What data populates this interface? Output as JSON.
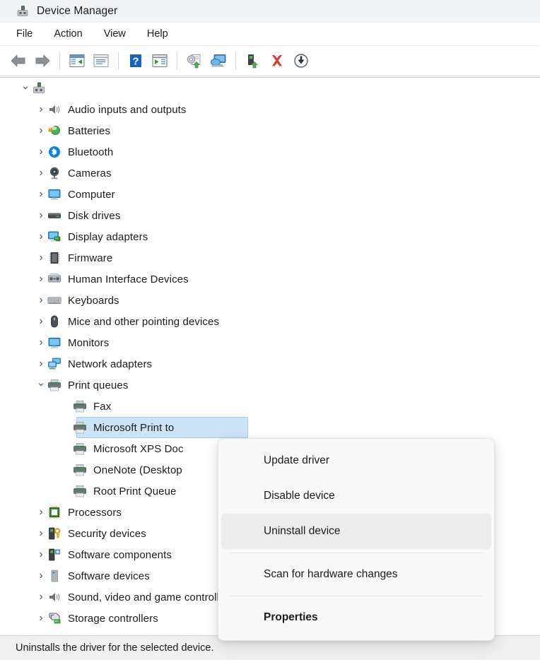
{
  "window": {
    "title": "Device Manager",
    "title_icon": "device-manager-icon"
  },
  "menubar": {
    "items": [
      {
        "label": "File",
        "name": "menu-file"
      },
      {
        "label": "Action",
        "name": "menu-action"
      },
      {
        "label": "View",
        "name": "menu-view"
      },
      {
        "label": "Help",
        "name": "menu-help"
      }
    ]
  },
  "toolbar": {
    "buttons": [
      {
        "icon": "back-arrow-icon",
        "title": "Back"
      },
      {
        "icon": "forward-arrow-icon",
        "title": "Forward"
      },
      {
        "icon": "show-hide-console-tree-icon",
        "title": "Show/Hide Console Tree"
      },
      {
        "icon": "properties-window-icon",
        "title": "Properties"
      },
      {
        "icon": "help-question-icon",
        "title": "Help"
      },
      {
        "icon": "show-hide-action-pane-icon",
        "title": "Show/Hide Action Pane"
      },
      {
        "icon": "update-driver-icon",
        "title": "Update driver"
      },
      {
        "icon": "scan-hardware-changes-icon",
        "title": "Scan for hardware changes"
      },
      {
        "icon": "disable-device-icon",
        "title": "Disable device"
      },
      {
        "icon": "uninstall-device-red-x-icon",
        "title": "Uninstall device"
      },
      {
        "icon": "download-circle-icon",
        "title": "Install legacy hardware"
      }
    ]
  },
  "tree": {
    "root": {
      "label": "",
      "icon": "computer-root-icon",
      "expanded": true
    },
    "items": [
      {
        "label": "Audio inputs and outputs",
        "icon": "speaker-icon",
        "level": 1,
        "expanded": false,
        "selected": false
      },
      {
        "label": "Batteries",
        "icon": "battery-icon",
        "level": 1,
        "expanded": false,
        "selected": false
      },
      {
        "label": "Bluetooth",
        "icon": "bluetooth-icon",
        "level": 1,
        "expanded": false,
        "selected": false
      },
      {
        "label": "Cameras",
        "icon": "camera-icon",
        "level": 1,
        "expanded": false,
        "selected": false
      },
      {
        "label": "Computer",
        "icon": "monitor-icon",
        "level": 1,
        "expanded": false,
        "selected": false
      },
      {
        "label": "Disk drives",
        "icon": "disk-drive-icon",
        "level": 1,
        "expanded": false,
        "selected": false
      },
      {
        "label": "Display adapters",
        "icon": "display-adapter-icon",
        "level": 1,
        "expanded": false,
        "selected": false
      },
      {
        "label": "Firmware",
        "icon": "firmware-chip-icon",
        "level": 1,
        "expanded": false,
        "selected": false
      },
      {
        "label": "Human Interface Devices",
        "icon": "hid-icon",
        "level": 1,
        "expanded": false,
        "selected": false
      },
      {
        "label": "Keyboards",
        "icon": "keyboard-icon",
        "level": 1,
        "expanded": false,
        "selected": false
      },
      {
        "label": "Mice and other pointing devices",
        "icon": "mouse-icon",
        "level": 1,
        "expanded": false,
        "selected": false
      },
      {
        "label": "Monitors",
        "icon": "monitor-icon",
        "level": 1,
        "expanded": false,
        "selected": false
      },
      {
        "label": "Network adapters",
        "icon": "network-adapter-icon",
        "level": 1,
        "expanded": false,
        "selected": false
      },
      {
        "label": "Print queues",
        "icon": "printer-icon",
        "level": 1,
        "expanded": true,
        "selected": false
      },
      {
        "label": "Fax",
        "icon": "printer-icon",
        "level": 2,
        "expanded": null,
        "selected": false
      },
      {
        "label": "Microsoft Print to",
        "icon": "printer-icon",
        "level": 2,
        "expanded": null,
        "selected": true
      },
      {
        "label": "Microsoft XPS Doc",
        "icon": "printer-icon",
        "level": 2,
        "expanded": null,
        "selected": false
      },
      {
        "label": "OneNote (Desktop",
        "icon": "printer-icon",
        "level": 2,
        "expanded": null,
        "selected": false
      },
      {
        "label": "Root Print Queue",
        "icon": "printer-icon",
        "level": 2,
        "expanded": null,
        "selected": false
      },
      {
        "label": "Processors",
        "icon": "processor-icon",
        "level": 1,
        "expanded": false,
        "selected": false
      },
      {
        "label": "Security devices",
        "icon": "security-device-icon",
        "level": 1,
        "expanded": false,
        "selected": false
      },
      {
        "label": "Software components",
        "icon": "software-component-icon",
        "level": 1,
        "expanded": false,
        "selected": false
      },
      {
        "label": "Software devices",
        "icon": "software-device-icon",
        "level": 1,
        "expanded": false,
        "selected": false
      },
      {
        "label": "Sound, video and game controllers",
        "icon": "speaker-icon",
        "level": 1,
        "expanded": false,
        "selected": false
      },
      {
        "label": "Storage controllers",
        "icon": "storage-controller-icon",
        "level": 1,
        "expanded": false,
        "selected": false
      }
    ]
  },
  "context_menu": {
    "items": [
      {
        "label": "Update driver",
        "name": "ctx-update-driver",
        "highlight": false,
        "bold": false,
        "sep_after": false
      },
      {
        "label": "Disable device",
        "name": "ctx-disable-device",
        "highlight": false,
        "bold": false,
        "sep_after": false
      },
      {
        "label": "Uninstall device",
        "name": "ctx-uninstall-device",
        "highlight": true,
        "bold": false,
        "sep_after": true
      },
      {
        "label": "Scan for hardware changes",
        "name": "ctx-scan-hardware",
        "highlight": false,
        "bold": false,
        "sep_after": true
      },
      {
        "label": "Properties",
        "name": "ctx-properties",
        "highlight": false,
        "bold": true,
        "sep_after": false
      }
    ]
  },
  "statusbar": {
    "text": "Uninstalls the driver for the selected device."
  },
  "colors": {
    "titlebar_bg": "#f3f4f6",
    "selection_bg": "#cce4f7",
    "selection_border": "#a8cdea",
    "menu_highlight": "#ededed",
    "statusbar_bg": "#f0f0f0",
    "accent_blue": "#0078d4",
    "red_x": "#d83b34",
    "green": "#4caf50"
  }
}
